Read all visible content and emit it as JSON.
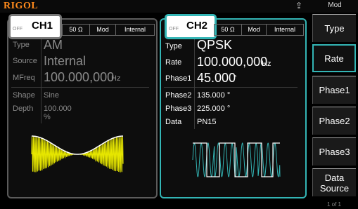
{
  "topbar": {
    "brand": "RIGOL",
    "usb_icon": "usb-icon",
    "menu_title": "Mod"
  },
  "ch1": {
    "name": "CH1",
    "output": "OFF",
    "status": {
      "impedance": "50 Ω",
      "mode": "Mod",
      "source": "Internal"
    },
    "type": {
      "label": "Type",
      "value": "AM"
    },
    "source": {
      "label": "Source",
      "value": "Internal"
    },
    "mfreq": {
      "label": "MFreq",
      "value": "100.000,000",
      "unit": "Hz"
    },
    "shape": {
      "label": "Shape",
      "value": "Sine"
    },
    "depth": {
      "label": "Depth",
      "value": "100.000 %"
    }
  },
  "ch2": {
    "name": "CH2",
    "output": "OFF",
    "status": {
      "impedance": "50 Ω",
      "mode": "Mod",
      "source": "Internal"
    },
    "type": {
      "label": "Type",
      "value": "QPSK"
    },
    "rate": {
      "label": "Rate",
      "value": "100.000,000",
      "unit": "Hz"
    },
    "phase1": {
      "label": "Phase1",
      "value": "45.000",
      "unit": "°"
    },
    "phase2": {
      "label": "Phase2",
      "value": "135.000 °"
    },
    "phase3": {
      "label": "Phase3",
      "value": "225.000 °"
    },
    "data": {
      "label": "Data",
      "value": "PN15"
    }
  },
  "menu": {
    "items": [
      {
        "label": "Type"
      },
      {
        "label": "Rate"
      },
      {
        "label": "Phase1"
      },
      {
        "label": "Phase2"
      },
      {
        "label": "Phase3"
      },
      {
        "label": "Data Source"
      }
    ],
    "page": "1 of 1"
  },
  "colors": {
    "accent": "#33b5b5",
    "brand": "#ff8a1c",
    "am_wave": "#e6e600"
  }
}
